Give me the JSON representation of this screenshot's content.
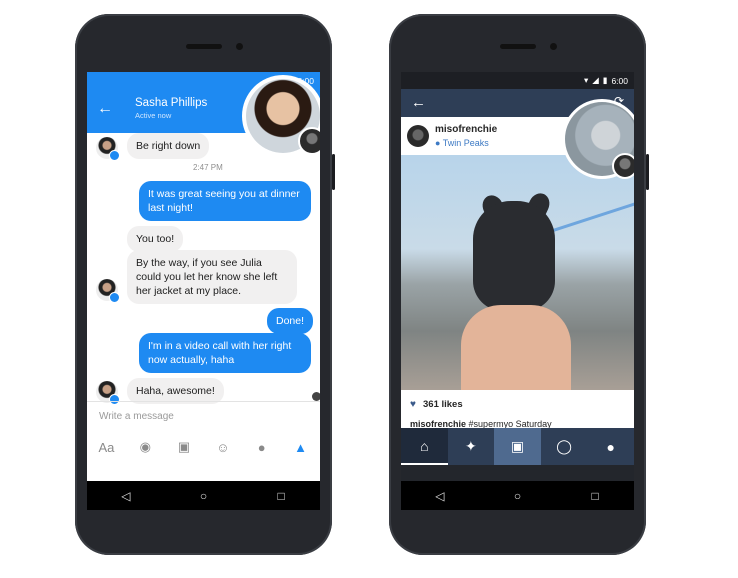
{
  "status": {
    "time": "6:00"
  },
  "messenger": {
    "contact_name": "Sasha Phillips",
    "contact_status": "Active now",
    "messages": [
      {
        "text": "Be right down"
      },
      {
        "text": "2:47 PM"
      },
      {
        "text": "It was great seeing you at dinner last night!"
      },
      {
        "text": "You too!"
      },
      {
        "text": "By the way, if you see Julia could you let her know she left her jacket at my place."
      },
      {
        "text": "Done!"
      },
      {
        "text": "I'm in a video call with her right now actually, haha"
      },
      {
        "text": "Haha, awesome!"
      }
    ],
    "input_placeholder": "Write a message",
    "tools": {
      "text_label": "Aa"
    },
    "accent": "#1e8af2"
  },
  "instagram": {
    "username": "misofrenchie",
    "location": "Twin Peaks",
    "likes": "361 likes",
    "caption_user": "misofrenchie",
    "caption_text": "#supermyo Saturday",
    "header_color": "#2e3e56"
  },
  "nav": {
    "back": "◁",
    "home": "○",
    "recent": "□"
  }
}
